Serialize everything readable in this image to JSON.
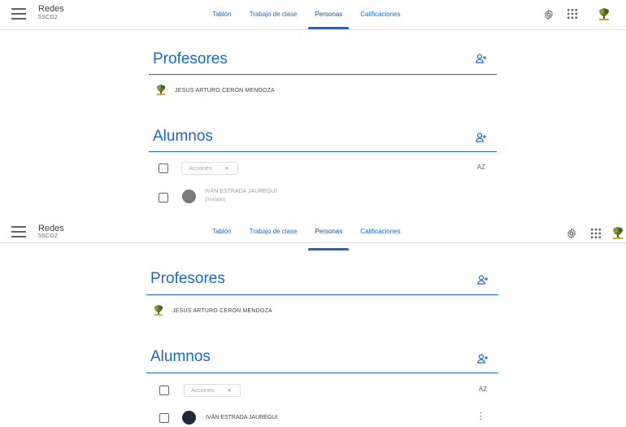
{
  "header": {
    "class_name": "Redes",
    "class_section": "5SCG2",
    "tabs": [
      "Tablón",
      "Trabajo de clase",
      "Personas",
      "Calificaciones"
    ],
    "active_tab": "Personas"
  },
  "teachers": {
    "title": "Profesores",
    "items": [
      {
        "name": "JESUS ARTURO CERÓN MENDOZA"
      }
    ]
  },
  "students": {
    "title": "Alumnos",
    "actions_label": "Acciones",
    "sort_label": "AZ",
    "panel1_student": {
      "name": "IVÁN ESTRADA JAUREGUI",
      "status": "(Invitado)"
    },
    "panel2_student": {
      "name": "IVÁN ESTRADA JAUREGUI"
    }
  },
  "colors": {
    "accent": "#1967d2",
    "text": "#3c4043",
    "muted": "#5f6368"
  }
}
